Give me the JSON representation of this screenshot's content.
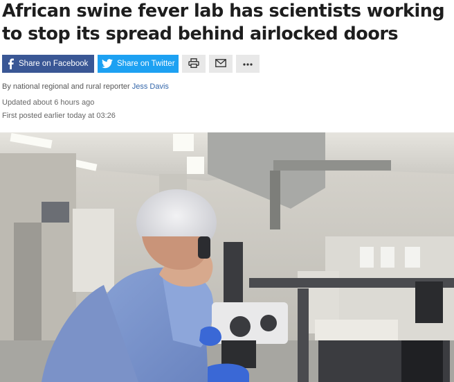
{
  "article": {
    "headline": "African swine fever lab has scientists working to stop its spread behind airlocked doors",
    "byline_prefix": "By national regional and rural reporter",
    "author": "Jess Davis",
    "updated": "Updated about 6 hours ago",
    "first_posted": "First posted earlier today at 03:26"
  },
  "share": {
    "facebook_label": "Share on Facebook",
    "twitter_label": "Share on Twitter",
    "print_icon": "print-icon",
    "email_icon": "email-icon",
    "more_icon": "more-icon"
  },
  "colors": {
    "facebook": "#3a5795",
    "twitter": "#1da1f2",
    "author_link": "#3366aa"
  }
}
